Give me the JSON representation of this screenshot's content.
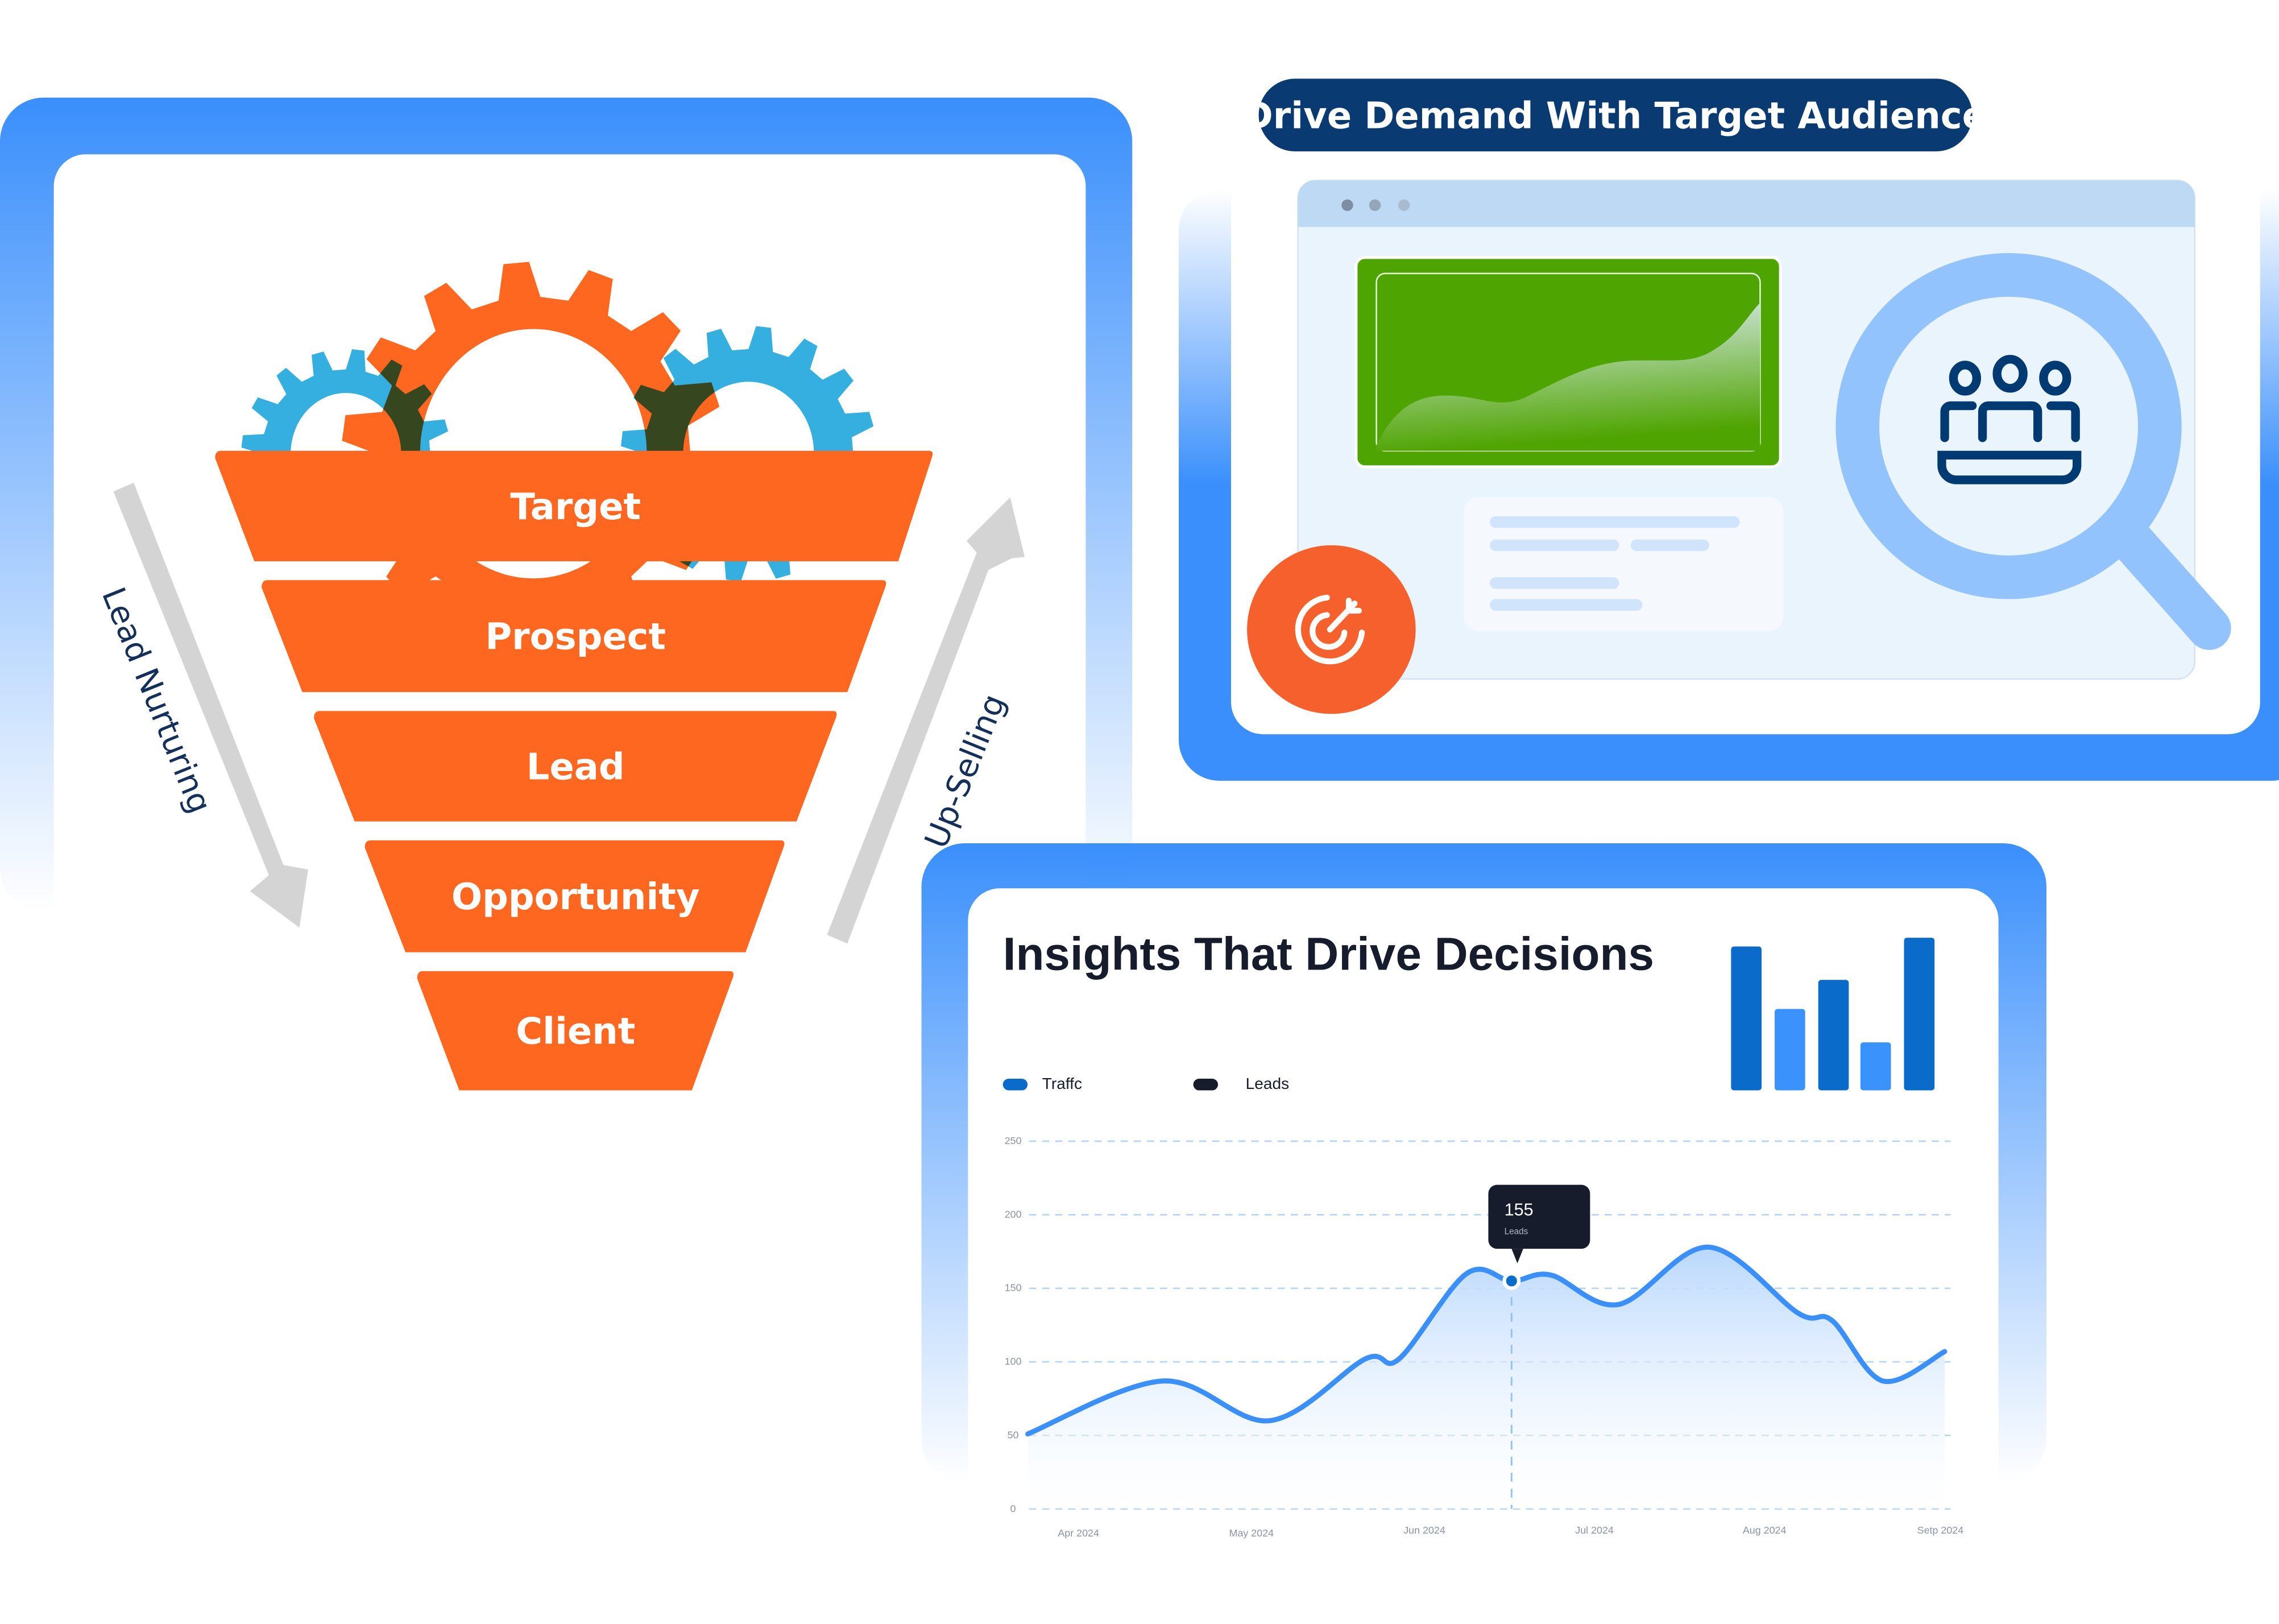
{
  "funnel": {
    "stages": [
      "Target",
      "Prospect",
      "Lead",
      "Opportunity",
      "Client"
    ],
    "left_arrow_label": "Lead Nurturing",
    "right_arrow_label": "Up-Selling",
    "colors": {
      "stage": "#fe6720",
      "gear_orange": "#fe6720",
      "gear_blue": "#35aee0",
      "gear_overlap": "#36461e",
      "arrow": "#d4d4d4"
    }
  },
  "demand_panel": {
    "title": "Drive Demand With Target Audience",
    "icons": [
      "target-arrow-icon",
      "magnifier-icon",
      "team-icon",
      "area-chart-icon"
    ],
    "colors": {
      "pill": "#0a3a72",
      "chart_bg": "#4ea400",
      "accent": "#f6602d",
      "magnifier": "#93c3fc"
    }
  },
  "insights_panel": {
    "title": "Insights That Drive Decisions",
    "legend": [
      {
        "label": "Traffc",
        "color": "#0a6bca"
      },
      {
        "label": "Leads",
        "color": "#161c2b"
      }
    ],
    "tooltip": {
      "value": "155",
      "label": "Leads"
    }
  },
  "chart_data": {
    "type": "area",
    "title": "",
    "xlabel": "",
    "ylabel": "",
    "ylim": [
      0,
      250
    ],
    "y_ticks": [
      "0",
      "50",
      "100",
      "150",
      "200",
      "250"
    ],
    "x_ticks": [
      "Apr 2024",
      "May 2024",
      "Jun 2024",
      "Jul 2024",
      "Aug 2024",
      "Setp 2024"
    ],
    "grid": true,
    "legend_position": "top-left",
    "series": [
      {
        "name": "Traffc",
        "color": "#3b8ff8",
        "points": [
          [
            "2024-03-23",
            51
          ],
          [
            "2024-04-16",
            87
          ],
          [
            "2024-05-05",
            60
          ],
          [
            "2024-05-22",
            102
          ],
          [
            "2024-05-28",
            102
          ],
          [
            "2024-06-09",
            160
          ],
          [
            "2024-06-17",
            155
          ],
          [
            "2024-06-24",
            159
          ],
          [
            "2024-07-06",
            139
          ],
          [
            "2024-07-22",
            178
          ],
          [
            "2024-08-07",
            133
          ],
          [
            "2024-08-13",
            128
          ],
          [
            "2024-08-22",
            87
          ],
          [
            "2024-09-02",
            107
          ]
        ]
      }
    ],
    "highlight": {
      "x": "2024-06-17",
      "value": 155,
      "label": "Leads"
    }
  }
}
